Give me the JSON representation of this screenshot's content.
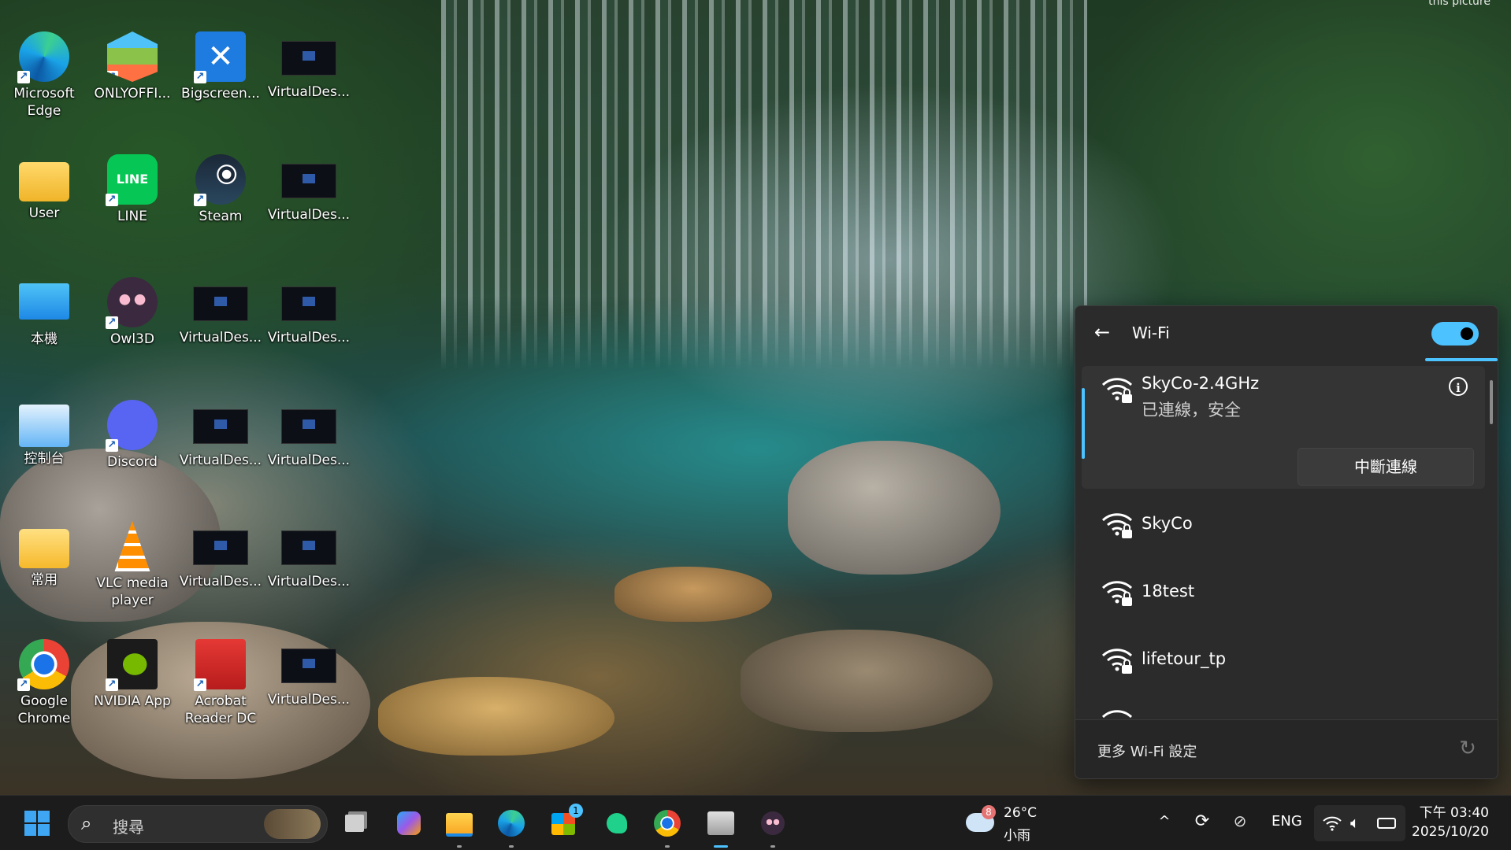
{
  "corner_text": "this picture",
  "desktop_icons": [
    {
      "label": "Microsoft Edge",
      "icon": "edge-icon"
    },
    {
      "label": "ONLYOFFI...",
      "icon": "onlyoffice-icon"
    },
    {
      "label": "Bigscreen...",
      "icon": "bigscreen-icon"
    },
    {
      "label": "VirtualDes...",
      "icon": "virtualdesktop-thumbnail"
    },
    {
      "label": "User",
      "icon": "user-folder-icon"
    },
    {
      "label": "LINE",
      "icon": "line-icon"
    },
    {
      "label": "Steam",
      "icon": "steam-icon"
    },
    {
      "label": "VirtualDes...",
      "icon": "virtualdesktop-thumbnail"
    },
    {
      "label": "本機",
      "icon": "this-pc-icon"
    },
    {
      "label": "Owl3D",
      "icon": "owl3d-icon"
    },
    {
      "label": "VirtualDes...",
      "icon": "virtualdesktop-thumbnail"
    },
    {
      "label": "VirtualDes...",
      "icon": "virtualdesktop-thumbnail"
    },
    {
      "label": "控制台",
      "icon": "control-panel-icon"
    },
    {
      "label": "Discord",
      "icon": "discord-icon"
    },
    {
      "label": "VirtualDes...",
      "icon": "virtualdesktop-thumbnail"
    },
    {
      "label": "VirtualDes...",
      "icon": "virtualdesktop-thumbnail"
    },
    {
      "label": "常用",
      "icon": "folder-icon"
    },
    {
      "label": "VLC media player",
      "icon": "vlc-icon"
    },
    {
      "label": "VirtualDes...",
      "icon": "virtualdesktop-thumbnail"
    },
    {
      "label": "VirtualDes...",
      "icon": "virtualdesktop-thumbnail"
    },
    {
      "label": "Google Chrome",
      "icon": "chrome-icon"
    },
    {
      "label": "NVIDIA App",
      "icon": "nvidia-icon"
    },
    {
      "label": "Acrobat Reader DC",
      "icon": "acrobat-icon"
    },
    {
      "label": "VirtualDes...",
      "icon": "virtualdesktop-thumbnail"
    }
  ],
  "wifi_flyout": {
    "title": "Wi-Fi",
    "toggle_on": true,
    "connected": {
      "ssid": "SkyCo-2.4GHz",
      "status": "已連線，安全",
      "disconnect_label": "中斷連線"
    },
    "networks": [
      {
        "ssid": "SkyCo"
      },
      {
        "ssid": "18test"
      },
      {
        "ssid": "lifetour_tp"
      }
    ],
    "more_settings": "更多 Wi-Fi 設定"
  },
  "taskbar": {
    "search_placeholder": "搜尋",
    "weather": {
      "temp": "26°C",
      "condition": "小雨",
      "badge": "8"
    },
    "store_badge": "1",
    "language": "ENG",
    "time": "下午 03:40",
    "date": "2025/10/20"
  },
  "colors": {
    "accent": "#4cc2ff",
    "flyout_bg": "#2b2b2b",
    "taskbar_bg": "#1c1c1c"
  }
}
